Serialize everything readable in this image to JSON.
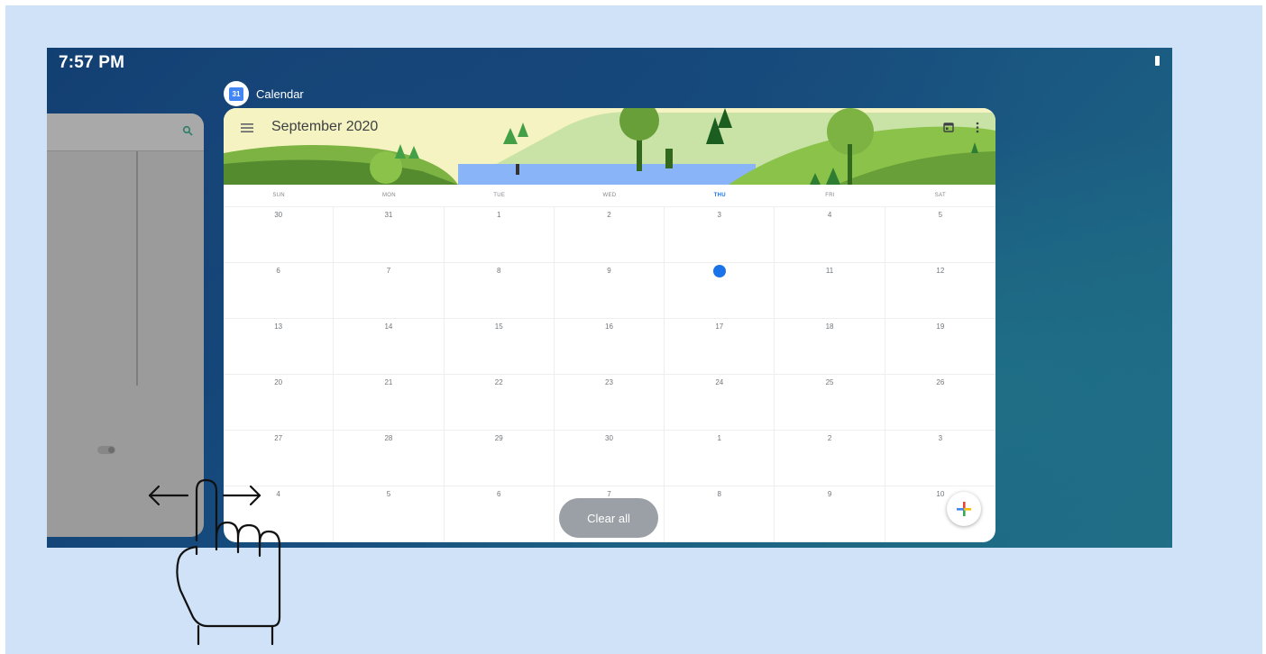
{
  "status_bar": {
    "time": "7:57 PM"
  },
  "recent_app": {
    "name": "Calendar",
    "icon_text": "31"
  },
  "calendar": {
    "month_title": "September 2020",
    "weekdays": [
      "SUN",
      "MON",
      "TUE",
      "WED",
      "THU",
      "FRI",
      "SAT"
    ],
    "active_weekday_index": 4,
    "today": "10",
    "days": [
      "30",
      "31",
      "1",
      "2",
      "3",
      "4",
      "5",
      "6",
      "7",
      "8",
      "9",
      "10",
      "11",
      "12",
      "13",
      "14",
      "15",
      "16",
      "17",
      "18",
      "19",
      "20",
      "21",
      "22",
      "23",
      "24",
      "25",
      "26",
      "27",
      "28",
      "29",
      "30",
      "1",
      "2",
      "3",
      "4",
      "5",
      "6",
      "7",
      "8",
      "9",
      "10"
    ]
  },
  "overview": {
    "clear_all_label": "Clear all"
  },
  "icons": {
    "menu": "menu-icon",
    "calendar_today": "calendar-icon",
    "more": "more-vert-icon",
    "search": "search-icon",
    "add": "add-icon",
    "gesture": "swipe-hand-icon"
  },
  "colors": {
    "accent": "#1a73e8",
    "background": "#cfe2f7",
    "clear_all_bg": "#9aa0a6"
  }
}
